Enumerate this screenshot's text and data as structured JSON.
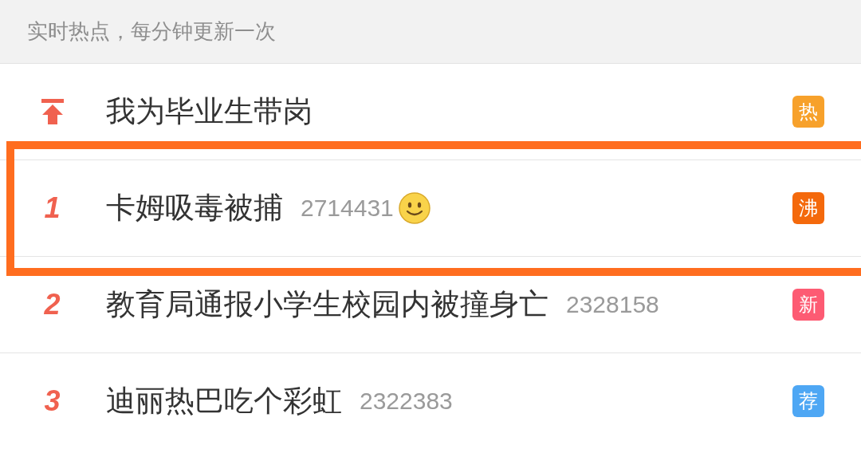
{
  "header": {
    "text": "实时热点，每分钟更新一次"
  },
  "items": [
    {
      "kind": "pinned",
      "title": "我为毕业生带岗",
      "badge": "热",
      "color": "#f7a12b",
      "emoji": false,
      "highlighted": false
    },
    {
      "kind": "ranked",
      "rank": "1",
      "title": "卡姆吸毒被捕",
      "count": "2714431",
      "badge": "沸",
      "color": "#f4690c",
      "emoji": true,
      "highlighted": true
    },
    {
      "kind": "ranked",
      "rank": "2",
      "title": "教育局通报小学生校园内被撞身亡",
      "count": "2328158",
      "badge": "新",
      "color": "#fd5b73",
      "emoji": false,
      "highlighted": false
    },
    {
      "kind": "ranked",
      "rank": "3",
      "title": "迪丽热巴吃个彩虹",
      "count": "2322383",
      "badge": "荐",
      "color": "#4ea7f4",
      "emoji": false,
      "highlighted": false
    }
  ]
}
